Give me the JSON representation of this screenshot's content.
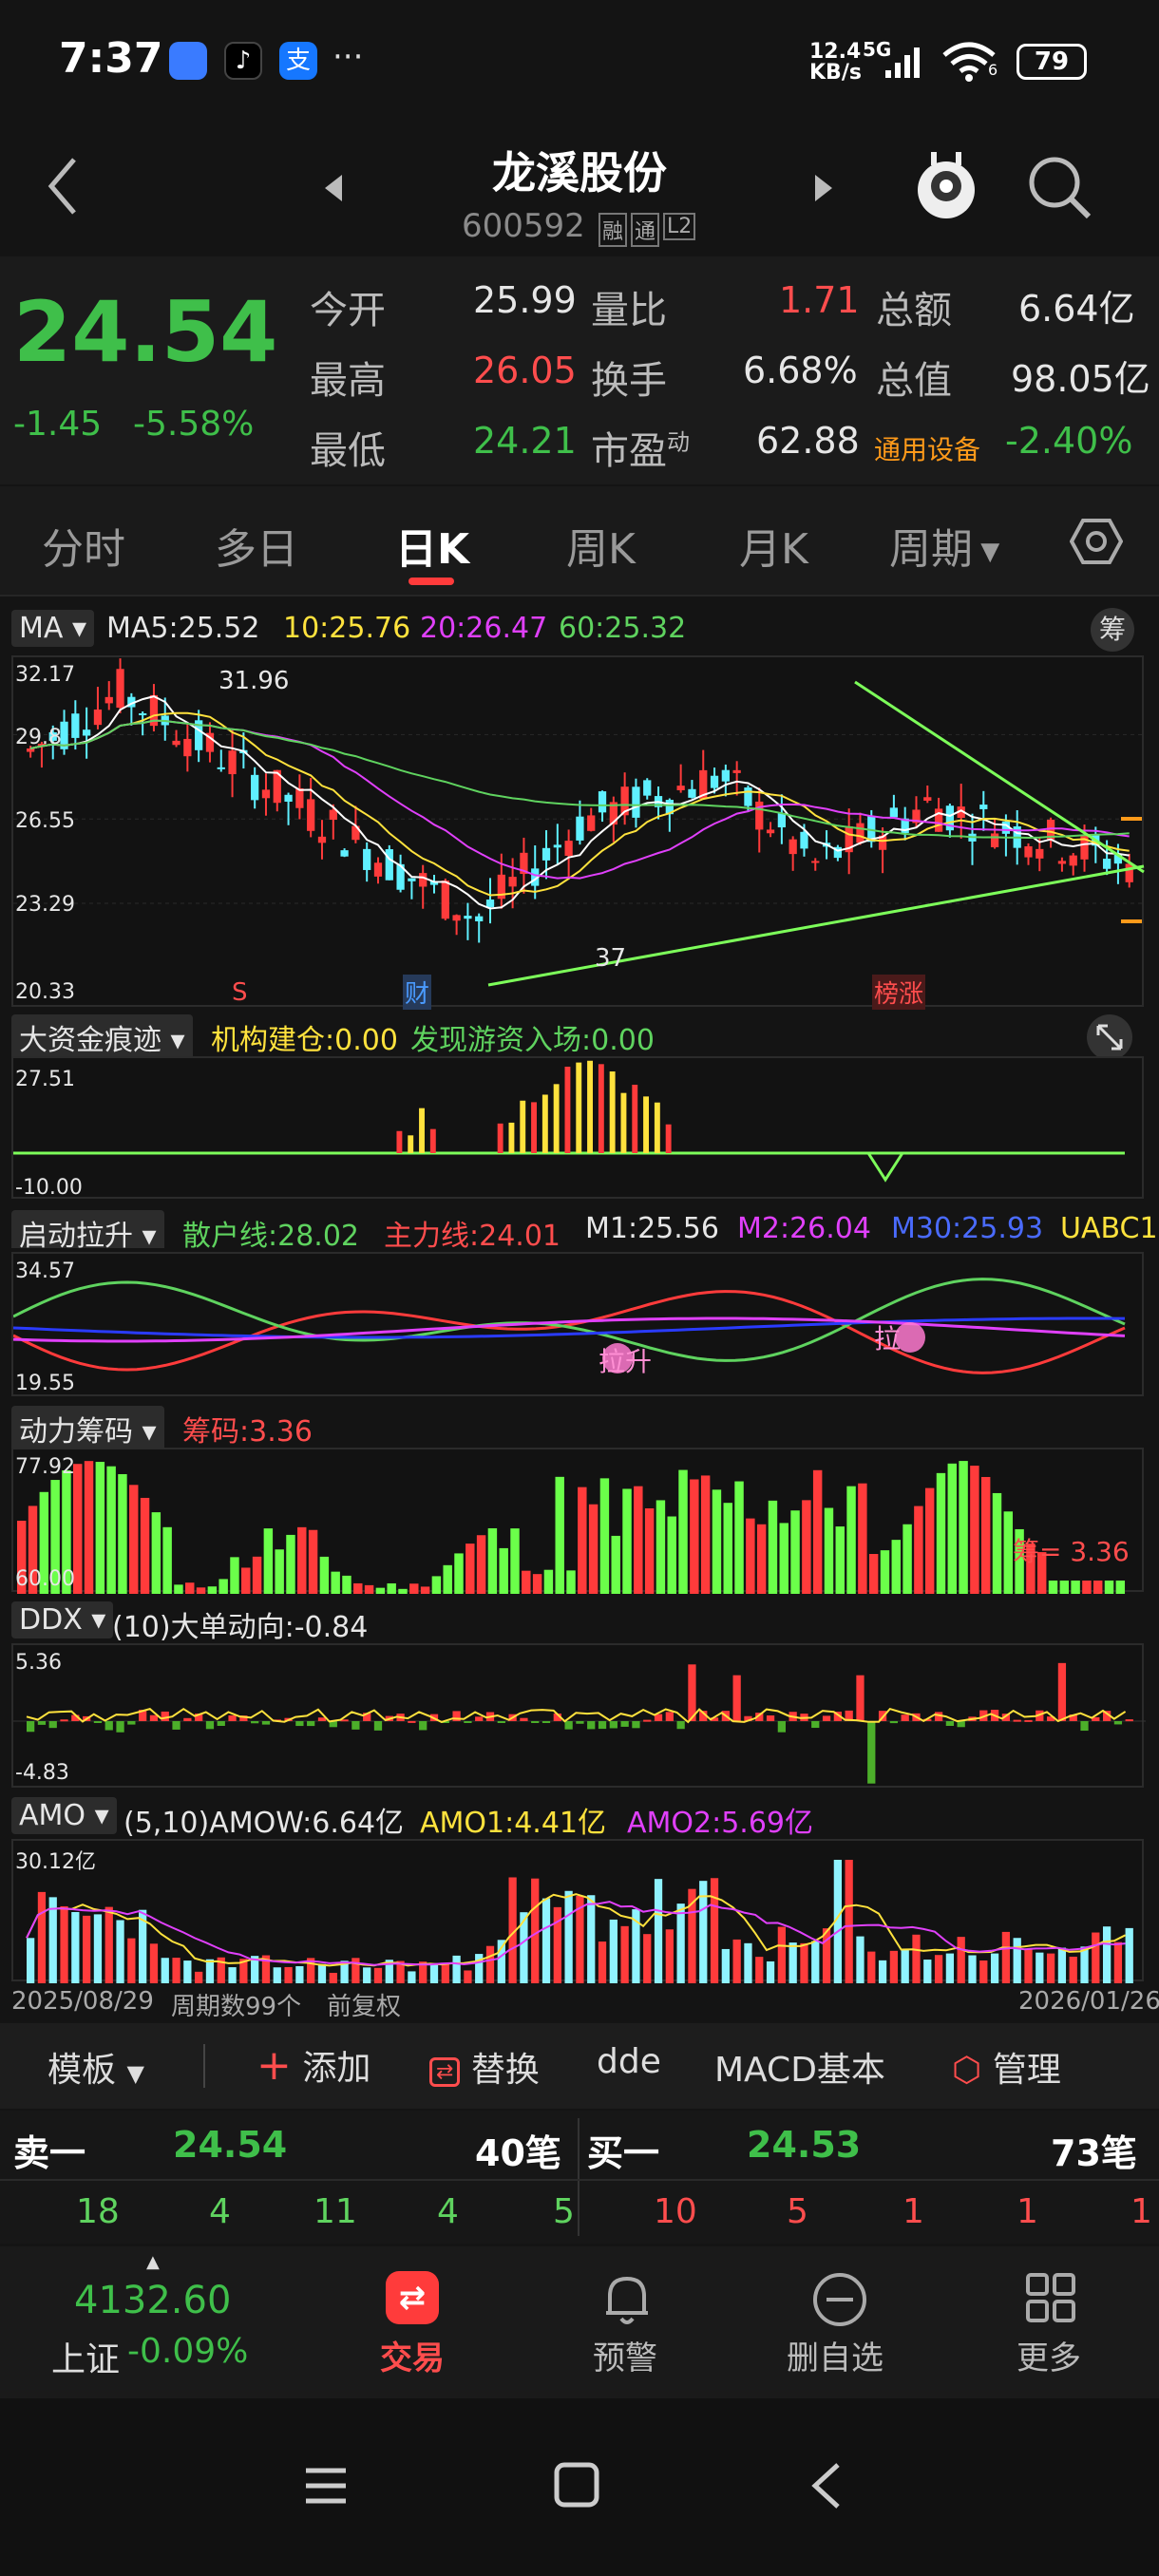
{
  "status_bar": {
    "time": "7:37",
    "net_speed": "12.4",
    "net_unit": "KB/s",
    "network": "5G",
    "wifi_num": "6",
    "battery": "79",
    "more": "···"
  },
  "header": {
    "title": "龙溪股份",
    "code": "600592",
    "badges": [
      "融",
      "通",
      "L2"
    ]
  },
  "quote": {
    "price": "24.54",
    "change": "-1.45",
    "change_pct": "-5.58%",
    "open_label": "今开",
    "open": "25.99",
    "high_label": "最高",
    "high": "26.05",
    "low_label": "最低",
    "low": "24.21",
    "vol_ratio_label": "量比",
    "vol_ratio": "1.71",
    "turnover_label": "换手",
    "turnover": "6.68%",
    "pe_label": "市盈",
    "pe_sup": "动",
    "pe": "62.88",
    "amount_label": "总额",
    "amount": "6.64亿",
    "mktcap_label": "总值",
    "mktcap": "98.05亿",
    "sector": "通用设备",
    "sector_change": "-2.40%"
  },
  "tabs": [
    "分时",
    "多日",
    "日K",
    "周K",
    "月K",
    "周期"
  ],
  "kline": {
    "indicator": "MA",
    "ma5": "MA5:25.52",
    "ma10": "10:25.76",
    "ma20": "20:26.47",
    "ma60": "60:25.32",
    "chip_label": "筹",
    "y_labels": [
      "32.17",
      "29.8",
      "26.55",
      "23.29",
      "20.33"
    ],
    "high_mark": "31.96",
    "low_mark": "37",
    "markers": [
      "S",
      "财",
      "榜涨"
    ]
  },
  "funds": {
    "name": "大资金痕迹",
    "inst": "机构建仓:0.00",
    "hot": "发现游资入场:0.00",
    "y_top": "27.51",
    "y_bot": "-10.00"
  },
  "launch": {
    "name": "启动拉升",
    "retail": "散户线:28.02",
    "main": "主力线:24.01",
    "m1": "M1:25.56",
    "m2": "M2:26.04",
    "m30": "M30:25.93",
    "uabc": "UABC1",
    "y_top": "34.57",
    "y_bot": "19.55",
    "tag1": "拉升",
    "tag2": "拉"
  },
  "chips": {
    "name": "动力筹码",
    "value": "筹码:3.36",
    "y_top": "77.92",
    "y_bot": "60.00",
    "note": "筹= 3.36"
  },
  "ddx": {
    "name": "DDX",
    "value": "(10)大单动向:-0.84",
    "y_top": "5.36",
    "y_bot": "-4.83"
  },
  "amo": {
    "name": "AMO",
    "amow": "(5,10)AMOW:6.64亿",
    "amo1": "AMO1:4.41亿",
    "amo2": "AMO2:5.69亿",
    "y_top": "30.12亿",
    "date_start": "2025/08/29",
    "period": "周期数99个",
    "adjust": "前复权",
    "date_end": "2026/01/26"
  },
  "toolbar": {
    "template": "模板",
    "add": "添加",
    "replace": "替换",
    "dde": "dde",
    "macd": "MACD基本",
    "manage": "管理"
  },
  "orderbook": {
    "sell_label": "卖一",
    "sell_price": "24.54",
    "sell_count": "40笔",
    "buy_label": "买一",
    "buy_price": "24.53",
    "buy_count": "73笔",
    "sell_detail": [
      "18",
      "4",
      "11",
      "4",
      "5"
    ],
    "buy_detail": [
      "10",
      "5",
      "1",
      "1",
      "1"
    ]
  },
  "bottom_nav": {
    "index_value": "4132.60",
    "index_name": "上证",
    "index_change": "-0.09%",
    "trade": "交易",
    "alert": "预警",
    "remove": "删自选",
    "more": "更多"
  }
}
